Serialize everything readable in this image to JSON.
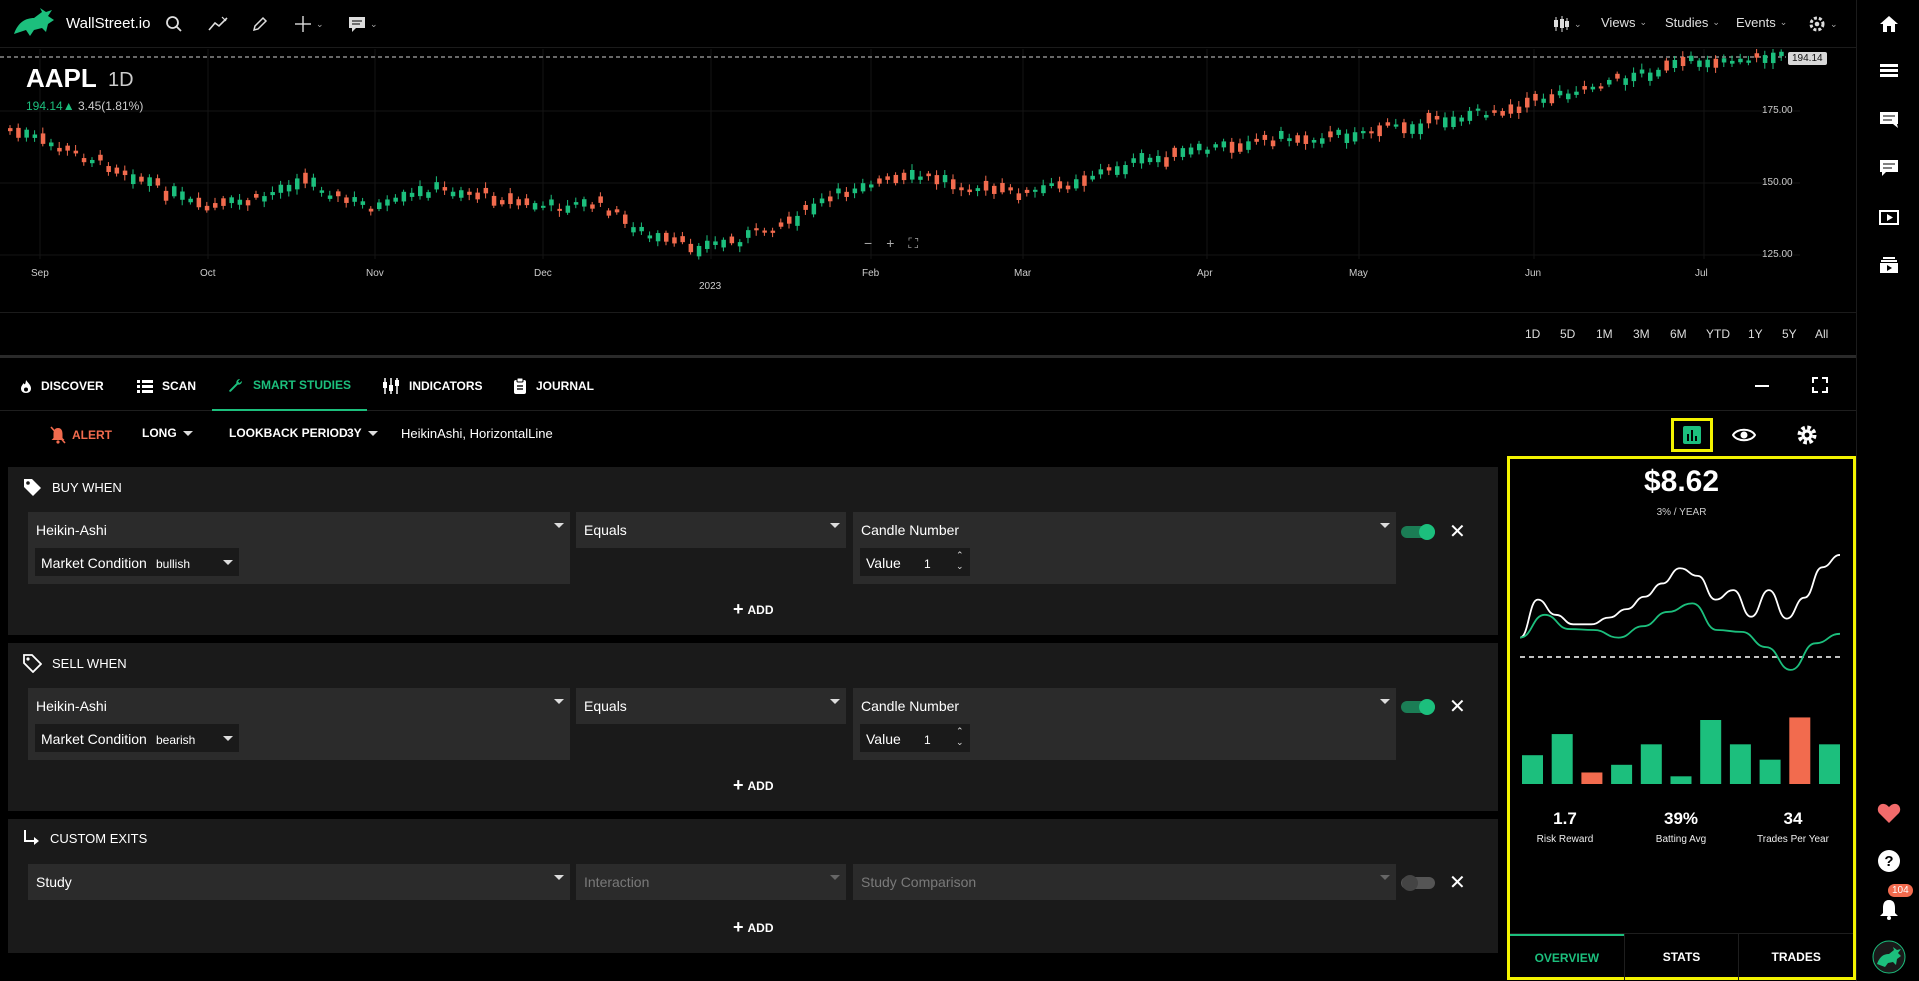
{
  "app": {
    "brand": "WallStreet.io"
  },
  "topbar": {
    "views_label": "Views",
    "studies_label": "Studies",
    "events_label": "Events"
  },
  "chart": {
    "ticker": "AAPL",
    "timeframe": "1D",
    "price": "194.14",
    "change": "3.45(1.81%)",
    "last_price_tag": "194.14",
    "y_labels": [
      "175.00",
      "150.00",
      "125.00"
    ],
    "months": [
      "Sep",
      "Oct",
      "Nov",
      "Dec",
      "2023",
      "Feb",
      "Mar",
      "Apr",
      "May",
      "Jun",
      "Jul"
    ],
    "colors": {
      "up": "#1cbf7d",
      "down": "#f26b4e"
    }
  },
  "ranges": [
    "1D",
    "5D",
    "1M",
    "3M",
    "6M",
    "YTD",
    "1Y",
    "5Y",
    "All"
  ],
  "tabs": [
    {
      "label": "DISCOVER",
      "icon": "flame-icon"
    },
    {
      "label": "SCAN",
      "icon": "list-icon"
    },
    {
      "label": "SMART STUDIES",
      "icon": "wrench-icon"
    },
    {
      "label": "INDICATORS",
      "icon": "indicators-icon"
    },
    {
      "label": "JOURNAL",
      "icon": "clipboard-icon"
    }
  ],
  "strategy": {
    "alert_label": "ALERT",
    "direction": "LONG",
    "lookback_label": "LOOKBACK PERIOD",
    "lookback_value": "3Y",
    "studies_list": "HeikinAshi, HorizontalLine"
  },
  "buy": {
    "title": "BUY WHEN",
    "study": "Heikin-Ashi",
    "param_label": "Market Condition",
    "param_value": "bullish",
    "operator": "Equals",
    "target": "Candle Number",
    "value_label": "Value",
    "value": "1",
    "add_label": "ADD"
  },
  "sell": {
    "title": "SELL WHEN",
    "study": "Heikin-Ashi",
    "param_label": "Market Condition",
    "param_value": "bearish",
    "operator": "Equals",
    "target": "Candle Number",
    "value_label": "Value",
    "value": "1",
    "add_label": "ADD"
  },
  "exits": {
    "title": "CUSTOM EXITS",
    "study": "Study",
    "operator_placeholder": "Interaction",
    "target_placeholder": "Study Comparison",
    "add_label": "ADD"
  },
  "results": {
    "profit": "$8.62",
    "per_year": "3% / YEAR",
    "stats": [
      {
        "value": "1.7",
        "label": "Risk Reward"
      },
      {
        "value": "39%",
        "label": "Batting Avg"
      },
      {
        "value": "34",
        "label": "Trades Per Year"
      }
    ],
    "tabs": [
      "OVERVIEW",
      "STATS",
      "TRADES"
    ],
    "bar_values": [
      0.45,
      0.78,
      0.18,
      0.3,
      0.62,
      0.12,
      1.0,
      0.62,
      0.38,
      1.04,
      0.62
    ],
    "bar_up": [
      true,
      true,
      false,
      true,
      true,
      true,
      true,
      true,
      true,
      false,
      true
    ],
    "strategy_line": [
      0.12,
      0.52,
      0.36,
      0.26,
      0.26,
      0.33,
      0.42,
      0.55,
      0.69,
      0.85,
      0.77,
      0.52,
      0.62,
      0.34,
      0.62,
      0.32,
      0.54,
      0.86,
      0.99
    ],
    "benchmark_line": [
      0.12,
      0.36,
      0.21,
      0.2,
      0.12,
      0.24,
      0.39,
      0.48,
      0.2,
      0.18,
      0.02,
      -0.22,
      0.06,
      0.16
    ],
    "accent": "#1cbf7d",
    "highlight": "#f3f300"
  },
  "rail": {
    "notification_count": "104"
  }
}
